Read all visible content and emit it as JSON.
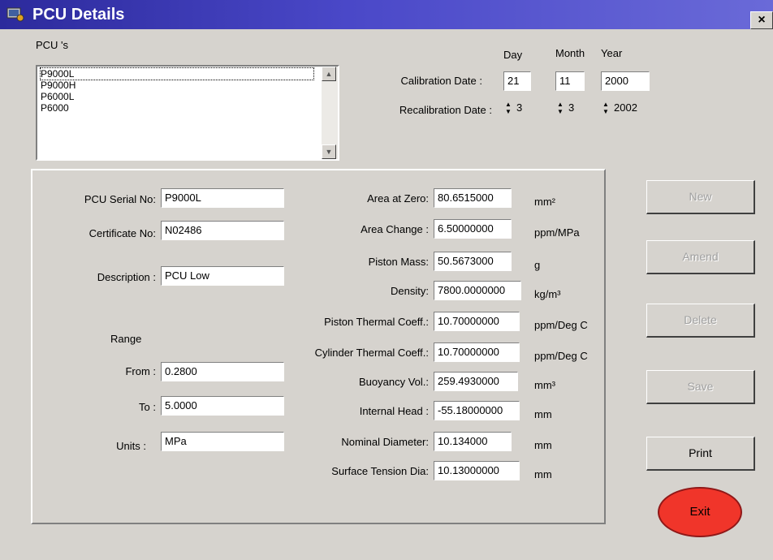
{
  "window": {
    "title": "PCU Details",
    "close_label": "×"
  },
  "pcu_list": {
    "label": "PCU 's",
    "items": [
      "P9000L",
      "P9000H",
      "P6000L",
      "P6000"
    ],
    "selected": "P9000L"
  },
  "dates": {
    "day_header": "Day",
    "month_header": "Month",
    "year_header": "Year",
    "calibration_label": "Calibration Date :",
    "calibration": {
      "day": "21",
      "month": "11",
      "year": "2000"
    },
    "recalibration_label": "Recalibration Date :",
    "recalibration": {
      "day": "3",
      "month": "3",
      "year": "2002"
    }
  },
  "left": {
    "serial_label": "PCU Serial No:",
    "serial": "P9000L",
    "cert_label": "Certificate No:",
    "cert": "N02486",
    "desc_label": "Description :",
    "desc": "PCU Low",
    "range_label": "Range",
    "from_label": "From :",
    "from": "0.2800",
    "to_label": "To :",
    "to": "5.0000",
    "units_label": "Units :",
    "units": "MPa"
  },
  "props": [
    {
      "label": "Area at Zero:",
      "value": "80.6515000",
      "unit": "mm²"
    },
    {
      "label": "Area Change :",
      "value": "6.50000000",
      "unit": "ppm/MPa"
    },
    {
      "label": "Piston Mass:",
      "value": "50.5673000",
      "unit": "g"
    },
    {
      "label": "Density:",
      "value": "7800.0000000",
      "unit": "kg/m³"
    },
    {
      "label": "Piston Thermal Coeff.:",
      "value": "10.70000000",
      "unit": "ppm/Deg C"
    },
    {
      "label": "Cylinder Thermal Coeff.:",
      "value": "10.70000000",
      "unit": "ppm/Deg C"
    },
    {
      "label": "Buoyancy Vol.:",
      "value": "259.4930000",
      "unit": "mm³"
    },
    {
      "label": "Internal Head :",
      "value": "-55.18000000",
      "unit": "mm"
    },
    {
      "label": "Nominal Diameter:",
      "value": "10.134000",
      "unit": "mm"
    },
    {
      "label": "Surface Tension Dia:",
      "value": "10.13000000",
      "unit": "mm"
    }
  ],
  "buttons": {
    "new": "New",
    "amend": "Amend",
    "delete": "Delete",
    "save": "Save",
    "print": "Print",
    "exit": "Exit"
  }
}
